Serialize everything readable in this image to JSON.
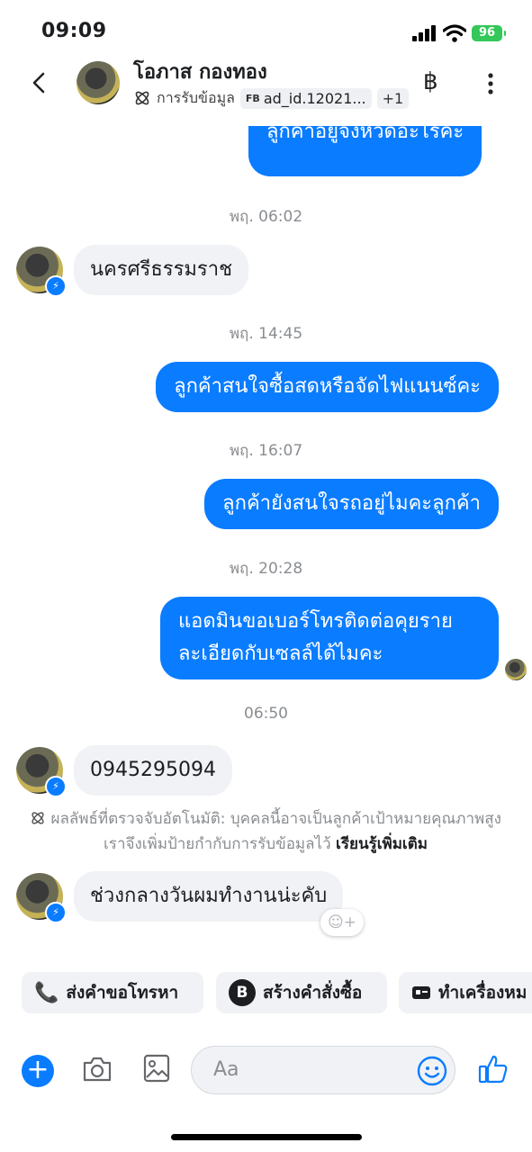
{
  "status": {
    "time": "09:09",
    "battery": "96"
  },
  "header": {
    "name": "โอภาส กองทอง",
    "label_text": "การรับข้อมูล",
    "chip_prefix": "FB",
    "chip_text": "ad_id.12021...",
    "extra_count": "+1",
    "baht_symbol": "฿",
    "more_symbol": "⋮",
    "back_symbol": "‹"
  },
  "messages": {
    "partial_out": "ลูกค้าอยู่จังหวัดอะไรคะ",
    "ts1": "พฤ. 06:02",
    "in1": "นครศรีธรรมราช",
    "ts2": "พฤ. 14:45",
    "out1": "ลูกค้าสนใจซื้อสดหรือจัดไฟแนนซ์คะ",
    "ts3": "พฤ. 16:07",
    "out2": "ลูกค้ายังสนใจรถอยู่ไมคะลูกค้า",
    "ts4": "พฤ. 20:28",
    "out3_line1": "แอดมินขอเบอร์โทรติดต่อคุยราย",
    "out3_line2": "ละเอียดกับเซลล์ได้ไมคะ",
    "ts5": "06:50",
    "in2": "0945295094",
    "info_text": "ผลลัพธ์ที่ตรวจจับอัตโนมัติ: บุคคลนี้อาจเป็นลูกค้าเป้าหมายคุณภาพสูง เราจึงเพิ่มป้ายกำกับการรับข้อมูลไว้",
    "info_link": "เรียนรู้เพิ่มเติม",
    "in3": "ช่วงกลางวันผมทำงานน่ะคับ"
  },
  "quick_actions": {
    "call": "ส่งคำขอโทรหา",
    "order": "สร้างคำสั่งซื้อ",
    "appt": "ทำเครื่องหม"
  },
  "composer": {
    "placeholder": "Aa"
  },
  "colors": {
    "accent": "#0a7cff",
    "bubble_in": "#f0f2f5"
  }
}
